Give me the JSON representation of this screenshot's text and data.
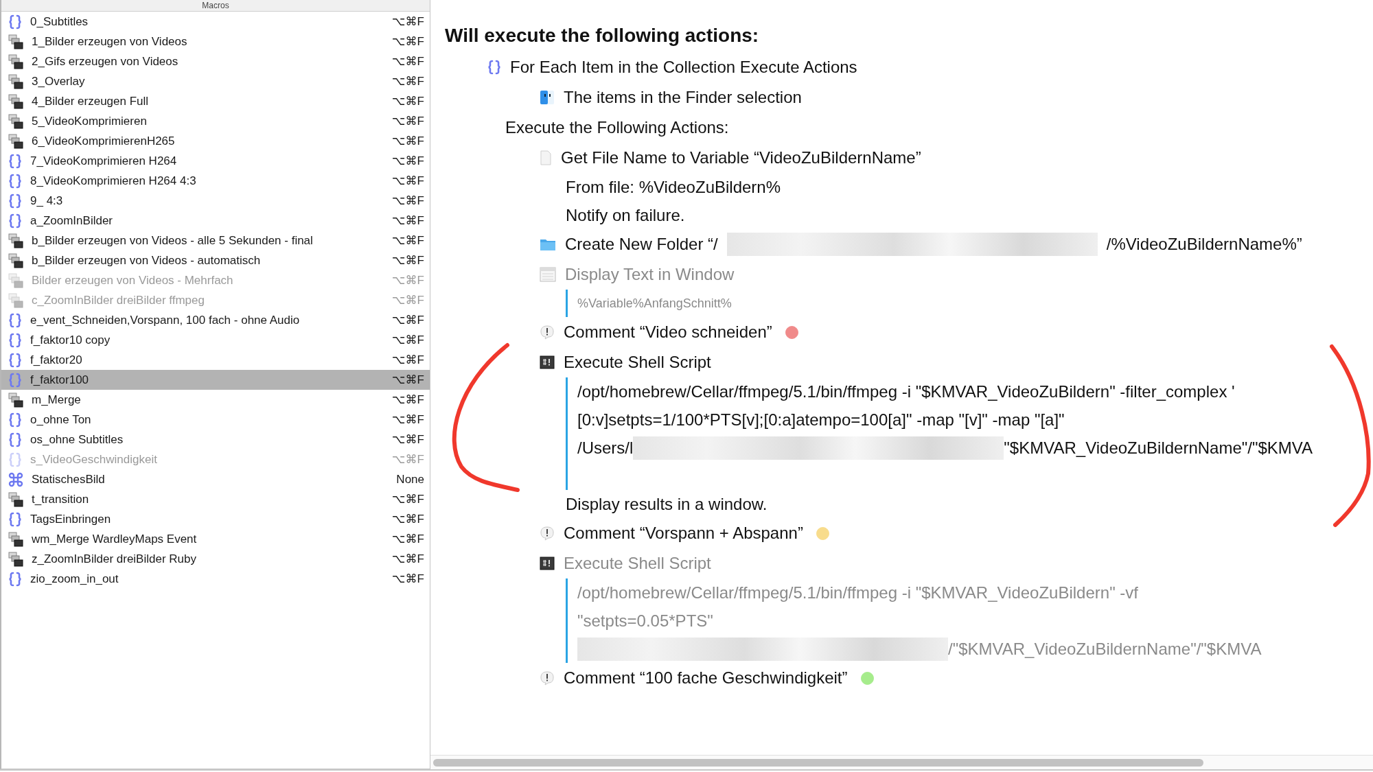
{
  "macros": {
    "header": "Macros",
    "items": [
      {
        "name": "0_Subtitles",
        "shortcut": "⌥⌘F",
        "kind": "group",
        "disabled": false,
        "selected": false
      },
      {
        "name": "1_Bilder erzeugen von Videos",
        "shortcut": "⌥⌘F",
        "kind": "windows",
        "disabled": false,
        "selected": false
      },
      {
        "name": "2_Gifs erzeugen von Videos",
        "shortcut": "⌥⌘F",
        "kind": "windows",
        "disabled": false,
        "selected": false
      },
      {
        "name": "3_Overlay",
        "shortcut": "⌥⌘F",
        "kind": "windows",
        "disabled": false,
        "selected": false
      },
      {
        "name": "4_Bilder erzeugen Full",
        "shortcut": "⌥⌘F",
        "kind": "windows",
        "disabled": false,
        "selected": false
      },
      {
        "name": "5_VideoKomprimieren",
        "shortcut": "⌥⌘F",
        "kind": "windows",
        "disabled": false,
        "selected": false
      },
      {
        "name": "6_VideoKomprimierenH265",
        "shortcut": "⌥⌘F",
        "kind": "windows",
        "disabled": false,
        "selected": false
      },
      {
        "name": "7_VideoKomprimieren H264",
        "shortcut": "⌥⌘F",
        "kind": "group",
        "disabled": false,
        "selected": false
      },
      {
        "name": "8_VideoKomprimieren H264 4:3",
        "shortcut": "⌥⌘F",
        "kind": "group",
        "disabled": false,
        "selected": false
      },
      {
        "name": "9_ 4:3",
        "shortcut": "⌥⌘F",
        "kind": "group",
        "disabled": false,
        "selected": false
      },
      {
        "name": "a_ZoomInBilder",
        "shortcut": "⌥⌘F",
        "kind": "group",
        "disabled": false,
        "selected": false
      },
      {
        "name": "b_Bilder erzeugen von Videos - alle 5 Sekunden - final",
        "shortcut": "⌥⌘F",
        "kind": "windows",
        "disabled": false,
        "selected": false
      },
      {
        "name": "b_Bilder erzeugen von Videos - automatisch",
        "shortcut": "⌥⌘F",
        "kind": "windows",
        "disabled": false,
        "selected": false
      },
      {
        "name": "Bilder erzeugen von Videos - Mehrfach",
        "shortcut": "⌥⌘F",
        "kind": "windows",
        "disabled": true,
        "selected": false
      },
      {
        "name": "c_ZoomInBilder dreiBilder ffmpeg",
        "shortcut": "⌥⌘F",
        "kind": "windows",
        "disabled": true,
        "selected": false
      },
      {
        "name": "e_vent_Schneiden,Vorspann, 100 fach - ohne Audio",
        "shortcut": "⌥⌘F",
        "kind": "group",
        "disabled": false,
        "selected": false
      },
      {
        "name": "f_faktor10 copy",
        "shortcut": "⌥⌘F",
        "kind": "group",
        "disabled": false,
        "selected": false
      },
      {
        "name": "f_faktor20",
        "shortcut": "⌥⌘F",
        "kind": "group",
        "disabled": false,
        "selected": false
      },
      {
        "name": "f_faktor100",
        "shortcut": "⌥⌘F",
        "kind": "group",
        "disabled": false,
        "selected": true
      },
      {
        "name": "m_Merge",
        "shortcut": "⌥⌘F",
        "kind": "windows",
        "disabled": false,
        "selected": false
      },
      {
        "name": "o_ohne Ton",
        "shortcut": "⌥⌘F",
        "kind": "group",
        "disabled": false,
        "selected": false
      },
      {
        "name": "os_ohne Subtitles",
        "shortcut": "⌥⌘F",
        "kind": "group",
        "disabled": false,
        "selected": false
      },
      {
        "name": "s_VideoGeschwindigkeit",
        "shortcut": "⌥⌘F",
        "kind": "group",
        "disabled": true,
        "selected": false
      },
      {
        "name": "StatischesBild",
        "shortcut": "None",
        "kind": "command",
        "disabled": false,
        "selected": false
      },
      {
        "name": "t_transition",
        "shortcut": "⌥⌘F",
        "kind": "windows",
        "disabled": false,
        "selected": false
      },
      {
        "name": "TagsEinbringen",
        "shortcut": "⌥⌘F",
        "kind": "group",
        "disabled": false,
        "selected": false
      },
      {
        "name": "wm_Merge WardleyMaps Event",
        "shortcut": "⌥⌘F",
        "kind": "windows",
        "disabled": false,
        "selected": false
      },
      {
        "name": "z_ZoomInBilder dreiBilder Ruby",
        "shortcut": "⌥⌘F",
        "kind": "windows",
        "disabled": false,
        "selected": false
      },
      {
        "name": "zio_zoom_in_out",
        "shortcut": "⌥⌘F",
        "kind": "group",
        "disabled": false,
        "selected": false
      }
    ]
  },
  "actions": {
    "heading": "Will execute the following actions:",
    "items": [
      {
        "kind": "foreach",
        "title": "For Each Item in the Collection Execute Actions",
        "source": "The items in the Finder selection",
        "body_label": "Execute the Following Actions:",
        "children": [
          {
            "kind": "file",
            "title": "Get File Name to Variable “VideoZuBildernName”",
            "disabled": false,
            "details": [
              "From file: %VideoZuBildern%",
              "Notify on failure."
            ]
          },
          {
            "kind": "folder",
            "title": "Create New Folder “/",
            "redacted": true,
            "title_after": "/%VideoZuBildernName%”",
            "disabled": false
          },
          {
            "kind": "window",
            "title": "Display Text in Window",
            "disabled": true,
            "script": [
              {
                "text": "%Variable%AnfangSchnitt%"
              }
            ]
          },
          {
            "kind": "comment",
            "title": "Comment “Video schneiden”",
            "color": "#f08a8a",
            "disabled": false
          },
          {
            "kind": "shell",
            "title": "Execute Shell Script",
            "disabled": false,
            "script": [
              {
                "text": "/opt/homebrew/Cellar/ffmpeg/5.1/bin/ffmpeg -i \"$KMVAR_VideoZuBildern\" -filter_complex '"
              },
              {
                "text": "[0:v]setpts=1/100*PTS[v];[0:a]atempo=100[a]\" -map \"[v]\" -map \"[a]\""
              },
              {
                "text": "/Users/l",
                "redacted": true,
                "after": "\"$KMVAR_VideoZuBildernName\"/\"$KMVA"
              }
            ],
            "details": [
              "Display results in a window."
            ]
          },
          {
            "kind": "comment",
            "title": "Comment “Vorspann + Abspann”",
            "color": "#f8dc8c",
            "disabled": false
          },
          {
            "kind": "shell",
            "title": "Execute Shell Script",
            "disabled": true,
            "script": [
              {
                "text": "/opt/homebrew/Cellar/ffmpeg/5.1/bin/ffmpeg -i \"$KMVAR_VideoZuBildern\" -vf"
              },
              {
                "text": "\"setpts=0.05*PTS\""
              },
              {
                "redacted": true,
                "after": "/\"$KMVAR_VideoZuBildernName\"/\"$KMVA"
              }
            ]
          },
          {
            "kind": "comment",
            "title": "Comment “100 fache Geschwindigkeit”",
            "color": "#a6ec8c",
            "disabled": false
          }
        ]
      }
    ]
  }
}
